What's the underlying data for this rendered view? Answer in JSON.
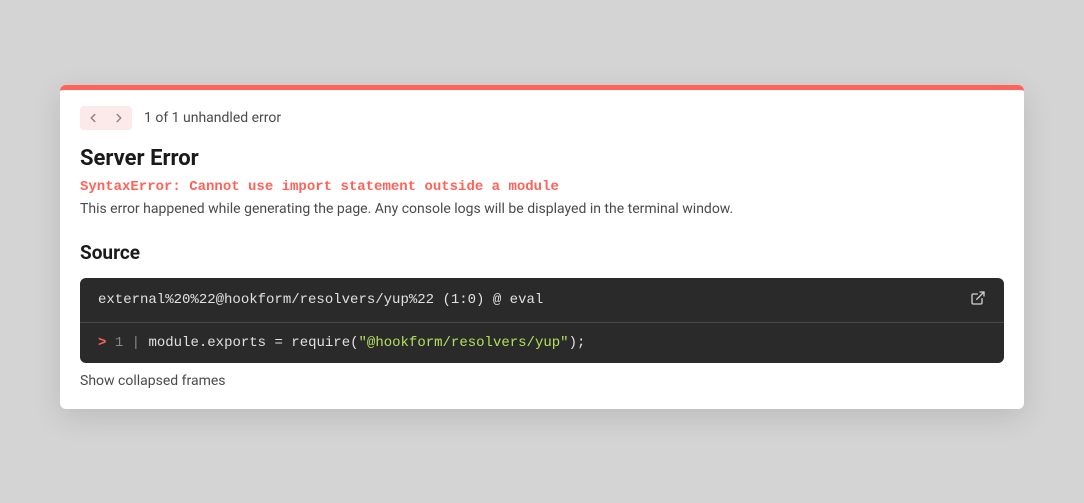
{
  "nav": {
    "error_count": "1 of 1 unhandled error"
  },
  "header": {
    "title": "Server Error",
    "error_message": "SyntaxError: Cannot use import statement outside a module",
    "description": "This error happened while generating the page. Any console logs will be displayed in the terminal window."
  },
  "source": {
    "title": "Source",
    "location": "external%20%22@hookform/resolvers/yup%22 (1:0) @ eval",
    "code": {
      "caret": ">",
      "line_num": "1",
      "pipe": "|",
      "seg1": "module",
      "dot1": ".",
      "seg2": "exports",
      "eq": " = ",
      "seg3": "require",
      "paren_open": "(",
      "string": "\"@hookform/resolvers/yup\"",
      "paren_close": ")",
      "semi": ";"
    }
  },
  "footer": {
    "show_frames": "Show collapsed frames"
  }
}
